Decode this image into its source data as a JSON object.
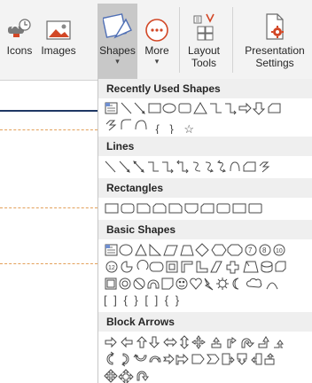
{
  "ribbon": {
    "buttons": [
      {
        "id": "icons",
        "label": "Icons",
        "icon": "icons-icon"
      },
      {
        "id": "images",
        "label": "Images",
        "icon": "images-icon"
      },
      {
        "id": "shapes",
        "label": "Shapes",
        "icon": "shapes-icon",
        "active": true,
        "dropdown": true
      },
      {
        "id": "more",
        "label": "More",
        "icon": "more-icon",
        "dropdown": true
      },
      {
        "id": "layout-tools",
        "label_line1": "Layout",
        "label_line2": "Tools",
        "icon": "layout-tools-icon"
      },
      {
        "id": "presentation-settings",
        "label_line1": "Presentation",
        "label_line2": "Settings",
        "icon": "presentation-settings-icon"
      }
    ]
  },
  "gallery": {
    "sections": [
      {
        "title": "Recently Used Shapes"
      },
      {
        "title": "Lines"
      },
      {
        "title": "Rectangles"
      },
      {
        "title": "Basic Shapes"
      },
      {
        "title": "Block Arrows"
      }
    ],
    "glyph_rows": {
      "recent_row2": "{ } ☆",
      "basic_row4": "[ ] { }  [  ]  {  }"
    }
  },
  "colors": {
    "accent_orange": "#d24726",
    "ribbon_bg": "#f3f3f3",
    "active_bg": "#c8c8c8",
    "section_bg": "#efefef",
    "shape_stroke": "#4a4a4a"
  }
}
